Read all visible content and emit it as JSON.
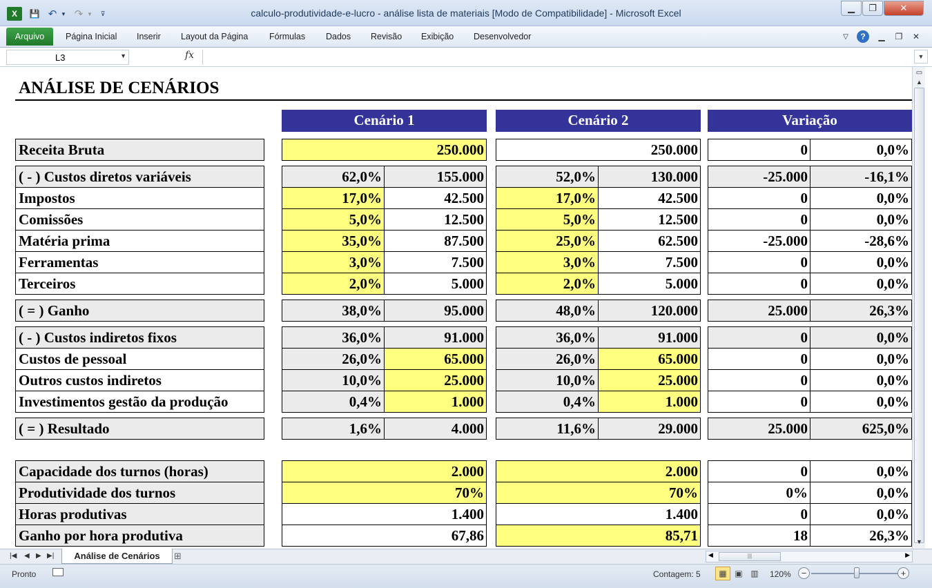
{
  "window": {
    "title": "calculo-produtividade-e-lucro - análise lista de materiais  [Modo de Compatibilidade]  -  Microsoft Excel",
    "qat_icons": [
      "excel-logo-icon",
      "save-icon",
      "undo-icon",
      "dropdown-icon",
      "redo-icon",
      "dropdown-icon",
      "customize-icon"
    ],
    "controls": [
      "minimize-icon",
      "restore-icon",
      "close-icon"
    ]
  },
  "ribbon": {
    "file_tab": "Arquivo",
    "tabs": [
      "Página Inicial",
      "Inserir",
      "Layout da Página",
      "Fórmulas",
      "Dados",
      "Revisão",
      "Exibição",
      "Desenvolvedor"
    ]
  },
  "formula_bar": {
    "name_box": "L3",
    "fx": "fx",
    "formula": ""
  },
  "sheet": {
    "title": "ANÁLISE DE CENÁRIOS",
    "headers": [
      "Cenário 1",
      "Cenário 2",
      "Variação"
    ],
    "rows": [
      {
        "label": "Receita Bruta",
        "c1_pct": "",
        "c1_val": "250.000",
        "c2_pct": "",
        "c2_val": "250.000",
        "var_val": "0",
        "var_pct": "0,0%"
      },
      {
        "label": "( - ) Custos diretos variáveis",
        "c1_pct": "62,0%",
        "c1_val": "155.000",
        "c2_pct": "52,0%",
        "c2_val": "130.000",
        "var_val": "-25.000",
        "var_pct": "-16,1%"
      },
      {
        "label": "Impostos",
        "c1_pct": "17,0%",
        "c1_val": "42.500",
        "c2_pct": "17,0%",
        "c2_val": "42.500",
        "var_val": "0",
        "var_pct": "0,0%"
      },
      {
        "label": "Comissões",
        "c1_pct": "5,0%",
        "c1_val": "12.500",
        "c2_pct": "5,0%",
        "c2_val": "12.500",
        "var_val": "0",
        "var_pct": "0,0%"
      },
      {
        "label": "Matéria prima",
        "c1_pct": "35,0%",
        "c1_val": "87.500",
        "c2_pct": "25,0%",
        "c2_val": "62.500",
        "var_val": "-25.000",
        "var_pct": "-28,6%"
      },
      {
        "label": "Ferramentas",
        "c1_pct": "3,0%",
        "c1_val": "7.500",
        "c2_pct": "3,0%",
        "c2_val": "7.500",
        "var_val": "0",
        "var_pct": "0,0%"
      },
      {
        "label": "Terceiros",
        "c1_pct": "2,0%",
        "c1_val": "5.000",
        "c2_pct": "2,0%",
        "c2_val": "5.000",
        "var_val": "0",
        "var_pct": "0,0%"
      },
      {
        "label": "( = ) Ganho",
        "c1_pct": "38,0%",
        "c1_val": "95.000",
        "c2_pct": "48,0%",
        "c2_val": "120.000",
        "var_val": "25.000",
        "var_pct": "26,3%"
      },
      {
        "label": "( - ) Custos indiretos fixos",
        "c1_pct": "36,0%",
        "c1_val": "91.000",
        "c2_pct": "36,0%",
        "c2_val": "91.000",
        "var_val": "0",
        "var_pct": "0,0%"
      },
      {
        "label": "Custos de pessoal",
        "c1_pct": "26,0%",
        "c1_val": "65.000",
        "c2_pct": "26,0%",
        "c2_val": "65.000",
        "var_val": "0",
        "var_pct": "0,0%"
      },
      {
        "label": "Outros custos indiretos",
        "c1_pct": "10,0%",
        "c1_val": "25.000",
        "c2_pct": "10,0%",
        "c2_val": "25.000",
        "var_val": "0",
        "var_pct": "0,0%"
      },
      {
        "label": "Investimentos gestão da produção",
        "c1_pct": "0,4%",
        "c1_val": "1.000",
        "c2_pct": "0,4%",
        "c2_val": "1.000",
        "var_val": "0",
        "var_pct": "0,0%"
      },
      {
        "label": "( = ) Resultado",
        "c1_pct": "1,6%",
        "c1_val": "4.000",
        "c2_pct": "11,6%",
        "c2_val": "29.000",
        "var_val": "25.000",
        "var_pct": "625,0%"
      },
      {
        "label": "Capacidade dos turnos (horas)",
        "c1_pct": "",
        "c1_val": "2.000",
        "c2_pct": "",
        "c2_val": "2.000",
        "var_val": "0",
        "var_pct": "0,0%"
      },
      {
        "label": "Produtividade dos turnos",
        "c1_pct": "",
        "c1_val": "70%",
        "c2_pct": "",
        "c2_val": "70%",
        "var_val": "0%",
        "var_pct": "0,0%"
      },
      {
        "label": "Horas produtivas",
        "c1_pct": "",
        "c1_val": "1.400",
        "c2_pct": "",
        "c2_val": "1.400",
        "var_val": "0",
        "var_pct": "0,0%"
      },
      {
        "label": "Ganho por hora produtiva",
        "c1_pct": "",
        "c1_val": "67,86",
        "c2_pct": "",
        "c2_val": "85,71",
        "var_val": "18",
        "var_pct": "26,3%"
      }
    ]
  },
  "sheet_tabs": {
    "active": "Análise de Cenários"
  },
  "status": {
    "ready": "Pronto",
    "count": "Contagem: 5",
    "zoom": "120%",
    "zoom_level_pct": 120
  },
  "colors": {
    "header_blue": "#333399",
    "input_yellow": "#ffff7f",
    "total_grey": "#ebebeb",
    "file_tab_green": "#2a8a35"
  }
}
